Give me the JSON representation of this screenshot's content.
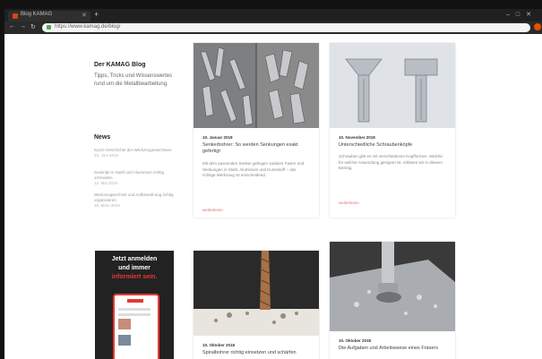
{
  "browser": {
    "tab_title": "Blog KAMAG",
    "url": "https://www.kamag.de/blog/"
  },
  "sidebar": {
    "blog_title": "Der KAMAG Blog",
    "blog_subtitle": "Tipps, Tricks und Wissenswertes rund um die Metallbearbeitung.",
    "news_heading": "News",
    "news_items": [
      {
        "title": "Kurze Geschichte der Werkzeugmaschinen",
        "date": "15. Juni 2019"
      },
      {
        "title": "Gewinde in Stahl und Aluminium richtig schneiden",
        "date": "12. Mai 2019"
      },
      {
        "title": "Werkzeugwechsel und Aufbewahrung richtig organisieren",
        "date": "28. März 2019"
      }
    ]
  },
  "cards": [
    {
      "date": "10. Januar 2019",
      "title": "Senkerbohrer: So werden Senkungen exakt gefertigt",
      "text": "Mit dem passenden Senker gelingen saubere Fasen und Senkungen in Stahl, Aluminium und Kunststoff – das richtige Werkzeug ist entscheidend.",
      "more": "weiterlesen"
    },
    {
      "date": "10. November 2018",
      "title": "Unterschiedliche Schraubenköpfe",
      "text": "Schrauben gibt es mit verschiedenen Kopfformen. Welche für welche Anwendung geeignet ist, erklären wir in diesem Beitrag.",
      "more": "weiterlesen"
    },
    {
      "date": "10. Oktober 2018",
      "title": "Spiralbohrer richtig einsetzen und schärfen"
    },
    {
      "date": "10. Oktober 2018",
      "title": "Die Aufgaben und Arbeitsweise eines Fräsers"
    }
  ],
  "ad": {
    "line1": "Jetzt anmelden",
    "line2": "und immer",
    "line3": "informiert sein."
  }
}
